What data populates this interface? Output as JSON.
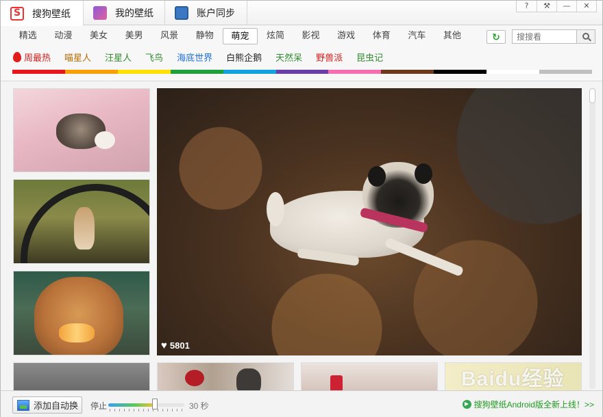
{
  "tabs": [
    {
      "label": "搜狗壁纸",
      "icon": "sogou-logo-icon"
    },
    {
      "label": "我的壁纸",
      "icon": "my-wallpaper-icon"
    },
    {
      "label": "账户同步",
      "icon": "account-sync-icon"
    }
  ],
  "window_buttons": [
    "?",
    "⚒",
    "—",
    "✕"
  ],
  "categories": [
    "精选",
    "动漫",
    "美女",
    "美男",
    "风景",
    "静物",
    "萌宠",
    "炫简",
    "影视",
    "游戏",
    "体育",
    "汽车",
    "其他"
  ],
  "active_category": "萌宠",
  "search": {
    "placeholder": "搜搜看"
  },
  "subcategories": [
    {
      "label": "周最热",
      "color": "#d81e1e"
    },
    {
      "label": "喵星人",
      "color": "#b86a00"
    },
    {
      "label": "汪星人",
      "color": "#2e8b2e"
    },
    {
      "label": "飞鸟",
      "color": "#2e8b2e"
    },
    {
      "label": "海底世界",
      "color": "#1e6fd6"
    },
    {
      "label": "白熊企鹅",
      "color": "#222222"
    },
    {
      "label": "天然呆",
      "color": "#2e8b2e"
    },
    {
      "label": "野兽派",
      "color": "#d81e1e"
    },
    {
      "label": "昆虫记",
      "color": "#2e8b2e"
    }
  ],
  "color_bar": [
    "#e8161a",
    "#f8a008",
    "#ffe000",
    "#1fa03c",
    "#13a2e0",
    "#6a3ea8",
    "#f36fb0",
    "#6b3a1c",
    "#000000",
    "#ffffff",
    "#c0c0c0"
  ],
  "hero": {
    "likes": "5801",
    "icon": "heart-icon"
  },
  "bottom": {
    "auto_change": "添加自动换",
    "stop_label": "停止",
    "interval_label": "30 秒",
    "promo": "搜狗壁纸Android版全新上线！>>"
  },
  "watermark": "Baidu经验"
}
